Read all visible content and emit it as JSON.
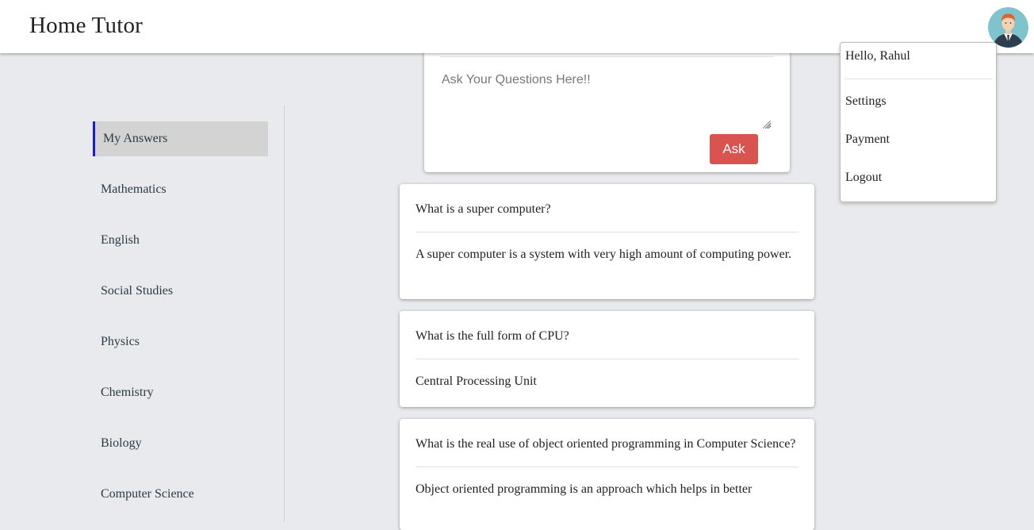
{
  "header": {
    "brand": "Home Tutor",
    "avatar_icon": "user-avatar-icon"
  },
  "sidebar": {
    "items": [
      {
        "label": "My Answers",
        "active": true
      },
      {
        "label": "Mathematics"
      },
      {
        "label": "English"
      },
      {
        "label": "Social Studies"
      },
      {
        "label": "Physics"
      },
      {
        "label": "Chemistry"
      },
      {
        "label": "Biology"
      },
      {
        "label": "Computer Science"
      }
    ]
  },
  "ask": {
    "placeholder": "Ask Your Questions Here!!",
    "button_label": "Ask",
    "button_color": "#d9534f"
  },
  "questions": [
    {
      "question": "What is a super computer?",
      "answer": "A super computer is a system with very high amount of computing power."
    },
    {
      "question": "What is the full form of CPU?",
      "answer": "Central Processing Unit"
    },
    {
      "question": "What is the real use of object oriented programming in Computer Science?",
      "answer": "Object oriented programming is an approach which helps in better"
    }
  ],
  "user_menu": {
    "greeting": "Hello, Rahul",
    "items": [
      "Settings",
      "Payment",
      "Logout"
    ]
  },
  "colors": {
    "background": "#e9eaed",
    "active_accent": "#1a1adb",
    "active_bg": "#d3d3d3"
  }
}
